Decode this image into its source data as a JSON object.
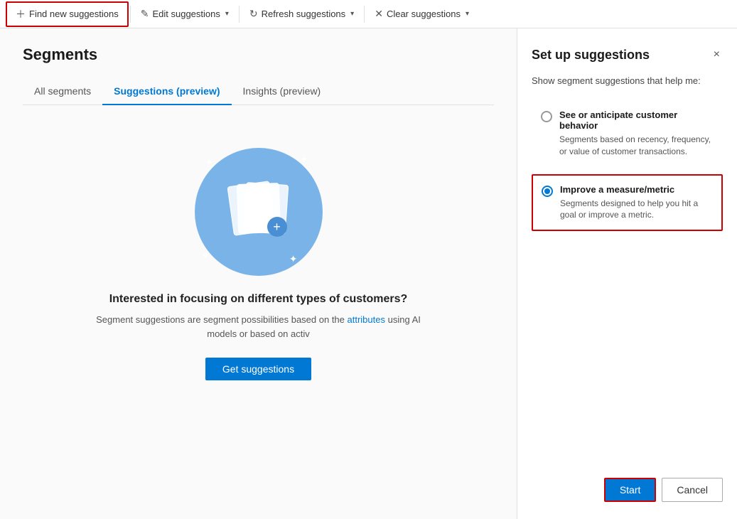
{
  "toolbar": {
    "find_new": "Find new suggestions",
    "edit": "Edit suggestions",
    "refresh": "Refresh suggestions",
    "clear": "Clear suggestions"
  },
  "page": {
    "title": "Segments",
    "tabs": [
      {
        "label": "All segments",
        "active": false
      },
      {
        "label": "Suggestions (preview)",
        "active": true
      },
      {
        "label": "Insights (preview)",
        "active": false
      }
    ]
  },
  "illustration": {
    "title": "Interested in focusing on different types of customers?",
    "description": "Segment suggestions are segment possibilities based on the attributes using AI models or based on activ",
    "get_btn": "Get suggestions"
  },
  "panel": {
    "title": "Set up suggestions",
    "subtitle": "Show segment suggestions that help me:",
    "close_icon": "×",
    "options": [
      {
        "id": "anticipate",
        "label": "See or anticipate customer behavior",
        "description": "Segments based on recency, frequency, or value of customer transactions.",
        "selected": false
      },
      {
        "id": "improve",
        "label": "Improve a measure/metric",
        "description": "Segments designed to help you hit a goal or improve a metric.",
        "selected": true
      }
    ],
    "start_btn": "Start",
    "cancel_btn": "Cancel"
  }
}
